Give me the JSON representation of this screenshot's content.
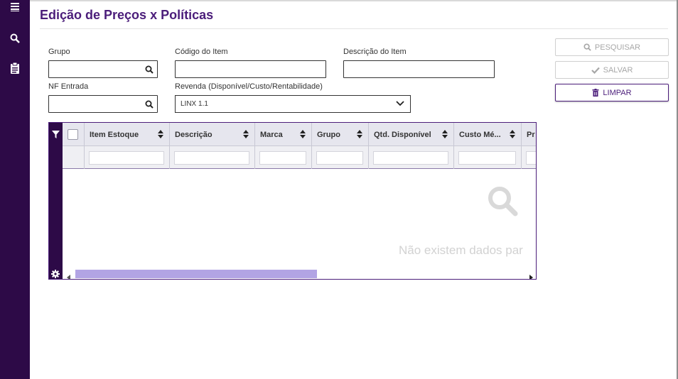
{
  "page": {
    "title": "Edição de Preços x Políticas"
  },
  "sidebar": {
    "icons": [
      "menu-icon",
      "search-icon",
      "clipboard-icon"
    ]
  },
  "filters": {
    "grupo": {
      "label": "Grupo",
      "value": ""
    },
    "codigo": {
      "label": "Código do Item",
      "value": ""
    },
    "descricao": {
      "label": "Descrição do Item",
      "value": ""
    },
    "nf": {
      "label": "NF Entrada",
      "value": ""
    },
    "revenda": {
      "label": "Revenda (Disponível/Custo/Rentabilidade)",
      "selected": "LINX 1.1"
    }
  },
  "actions": {
    "pesquisar": "PESQUISAR",
    "salvar": "SALVAR",
    "limpar": "LIMPAR"
  },
  "grid": {
    "columns": [
      "Item Estoque",
      "Descrição",
      "Marca",
      "Grupo",
      "Qtd. Disponível",
      "Custo Mé...",
      "Pr"
    ],
    "empty_message": "Não existem dados par"
  },
  "colors": {
    "primary": "#4b1d7a",
    "sidebar": "#2d0a47",
    "scroll_thumb": "#b2a4e4"
  }
}
